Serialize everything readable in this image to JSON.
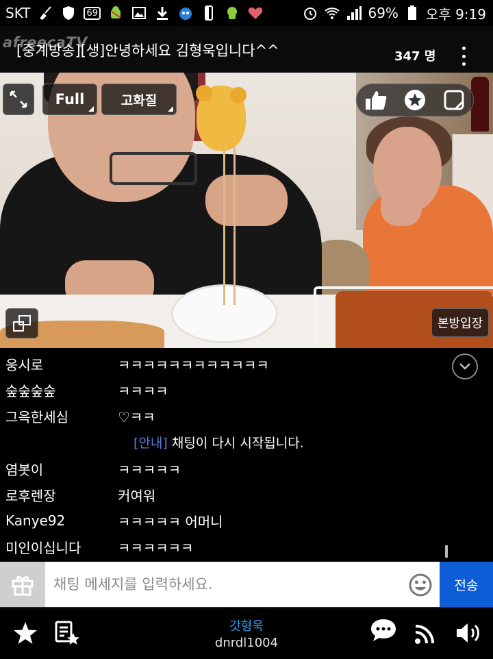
{
  "status_bar": {
    "carrier": "SKT",
    "notification_count": "69",
    "battery": "69%",
    "time": "오후 9:19",
    "icons": [
      "broom-icon",
      "shield-icon",
      "badge-69-icon",
      "android-icon",
      "image-icon",
      "download-icon",
      "tv-icon",
      "phone-icon",
      "android-green-icon",
      "heart-icon",
      "alarm-icon",
      "wifi-icon",
      "signal-icon",
      "battery-icon"
    ]
  },
  "header": {
    "logo": "afreecaTV",
    "title": "[중계방송][생]안녕하세요 김형욱입니다^^",
    "viewers": "347 명"
  },
  "player": {
    "full_label": "Full",
    "quality_label": "고화질",
    "entry_label": "본방입장"
  },
  "chat": {
    "messages": [
      {
        "nick": "웅시로",
        "text": "ㅋㅋㅋㅋㅋㅋㅋㅋㅋㅋㅋㅋ"
      },
      {
        "nick": "숲숲숲숲",
        "text": "ㅋㅋㅋㅋ"
      },
      {
        "nick": "그윽한세심",
        "text": "♡ㅋㅋ"
      },
      {
        "nick": "염봇이",
        "text": "ㅋㅋㅋㅋㅋ"
      },
      {
        "nick": "로후렌장",
        "text": "커여워"
      },
      {
        "nick": "Kanye92",
        "text": "ㅋㅋㅋㅋㅋ 어머니"
      },
      {
        "nick": "미인이십니다",
        "text": "ㅋㅋㅋㅋㅋㅋ"
      }
    ],
    "notice_tag": "[안내]",
    "notice_text": "채팅이 다시 시작됩니다."
  },
  "input": {
    "placeholder": "채팅 메세지를 입력하세요.",
    "send_label": "전송"
  },
  "bottom": {
    "bj_name": "갓형욱",
    "bj_id": "dnrdl1004"
  },
  "colors": {
    "send_button": "#0d5ed6",
    "notice_tag": "#5b7fe0",
    "bj_name": "#2aa3f5"
  }
}
